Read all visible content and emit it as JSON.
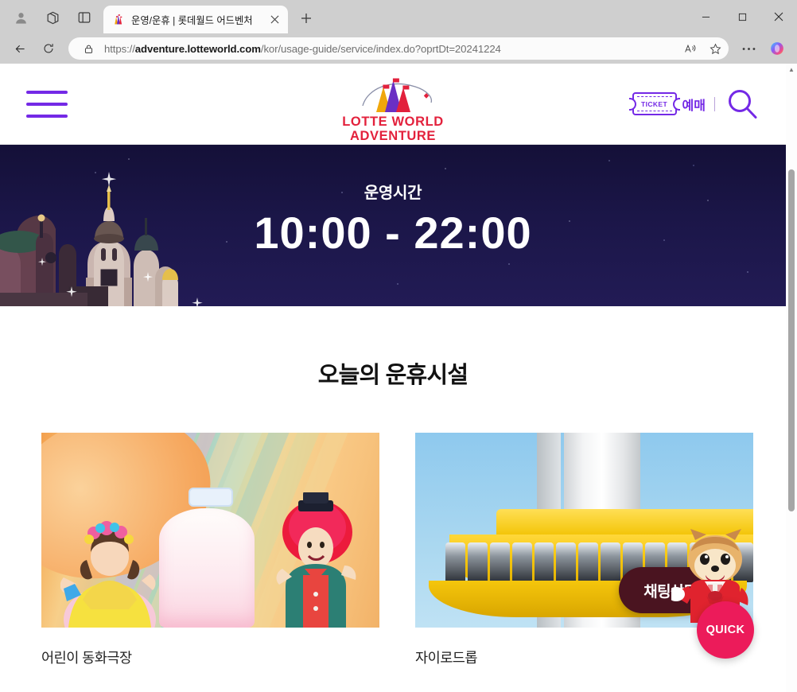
{
  "browser": {
    "window_controls": {
      "minimize": "minimize-button",
      "maximize": "maximize-button",
      "close": "close-button"
    },
    "tab": {
      "title": "운영/운휴 | 롯데월드 어드벤처",
      "favicon": "lotte-world-castle-icon",
      "close_label": "✕"
    },
    "new_tab_label": "+",
    "toolbar": {
      "profile_icon": "profile-avatar-icon",
      "workspaces_icon": "workspaces-icon",
      "tab_actions_icon": "split-screen-icon",
      "back_label": "←",
      "reload_label": "⟳",
      "lock_icon": "lock-icon",
      "read_aloud_icon": "read-aloud-icon",
      "favorite_icon": "star-icon",
      "settings_icon": "more-options-icon",
      "copilot_icon": "copilot-icon"
    },
    "address": {
      "scheme": "https://",
      "domain": "adventure.lotteworld.com",
      "path": "/kor/usage-guide/service/index.do?oprtDt=20241224",
      "full_url": "https://adventure.lotteworld.com/kor/usage-guide/service/index.do?oprtDt=20241224"
    }
  },
  "site": {
    "header": {
      "menu_icon": "hamburger-menu-icon",
      "logo": {
        "line1": "LOTTE WORLD",
        "line2": "ADVENTURE",
        "icon": "castle-towers-icon"
      },
      "ticket": {
        "icon_text": "TICKET",
        "label": "예매"
      },
      "search_icon": "search-icon"
    },
    "hero": {
      "label": "운영시간",
      "hours": "10:00 - 22:00",
      "open_time": "10:00",
      "close_time": "22:00",
      "background": "night-castle-photo"
    },
    "section": {
      "title": "오늘의 운휴시설",
      "cards": [
        {
          "caption": "어린이 동화극장",
          "image": "childrens-fairytale-theater-photo"
        },
        {
          "caption": "자이로드롭",
          "image": "gyro-drop-ride-photo"
        }
      ]
    },
    "quick_widget": {
      "chat_label": "채팅상담",
      "quick_label": "QUICK",
      "mascot": "lotty-mascot-icon"
    },
    "colors": {
      "brand_purple": "#7429e6",
      "logo_red": "#e3213c",
      "hero_navy": "#191544",
      "quick_pink": "#ec1b5a",
      "chat_maroon": "#4a1420"
    }
  }
}
